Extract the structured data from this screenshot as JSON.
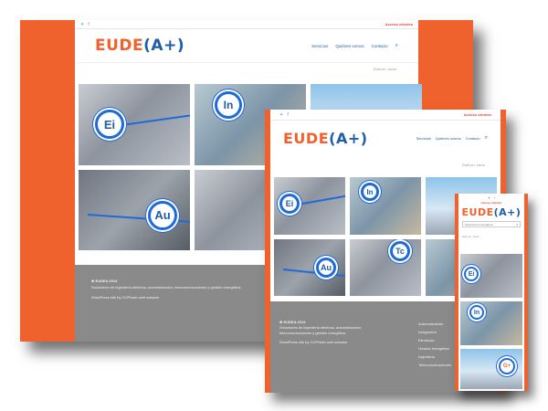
{
  "brand": {
    "logo_left": "EUDE",
    "logo_right": "(A+)"
  },
  "topbar": {
    "access_label": "Acceso clientes",
    "twitter_icon": "twitter-icon",
    "facebook_icon": "facebook-icon"
  },
  "nav": {
    "items": [
      "Servicios",
      "Quiénes somos",
      "Contacto"
    ],
    "search_icon": "search-icon"
  },
  "breadcrumb": "Está en: Inicio",
  "tiles": {
    "ei": "Ei",
    "in": "In",
    "au": "Au",
    "tc": "Tc",
    "g": "G+"
  },
  "footer": {
    "brand": "⊕ EUDEA 2014",
    "description": "Soluciones de ingeniería eléctrica, automatización, telecomunicaciones y gestión energética.",
    "credit": "WordPress site by COPIweb web sotware",
    "links": [
      "Automatización",
      "Integración",
      "Electricas",
      "Gestión energética",
      "Ingeniería",
      "Telecomunicaciones"
    ]
  },
  "phone": {
    "access_label": "Acceso clientes",
    "menu_label": "Selecciona una página",
    "crumb": "Está en: Inicio"
  },
  "colors": {
    "orange": "#f0622d",
    "blue": "#1e5fa8",
    "footer_gray": "#8a8a8a"
  }
}
